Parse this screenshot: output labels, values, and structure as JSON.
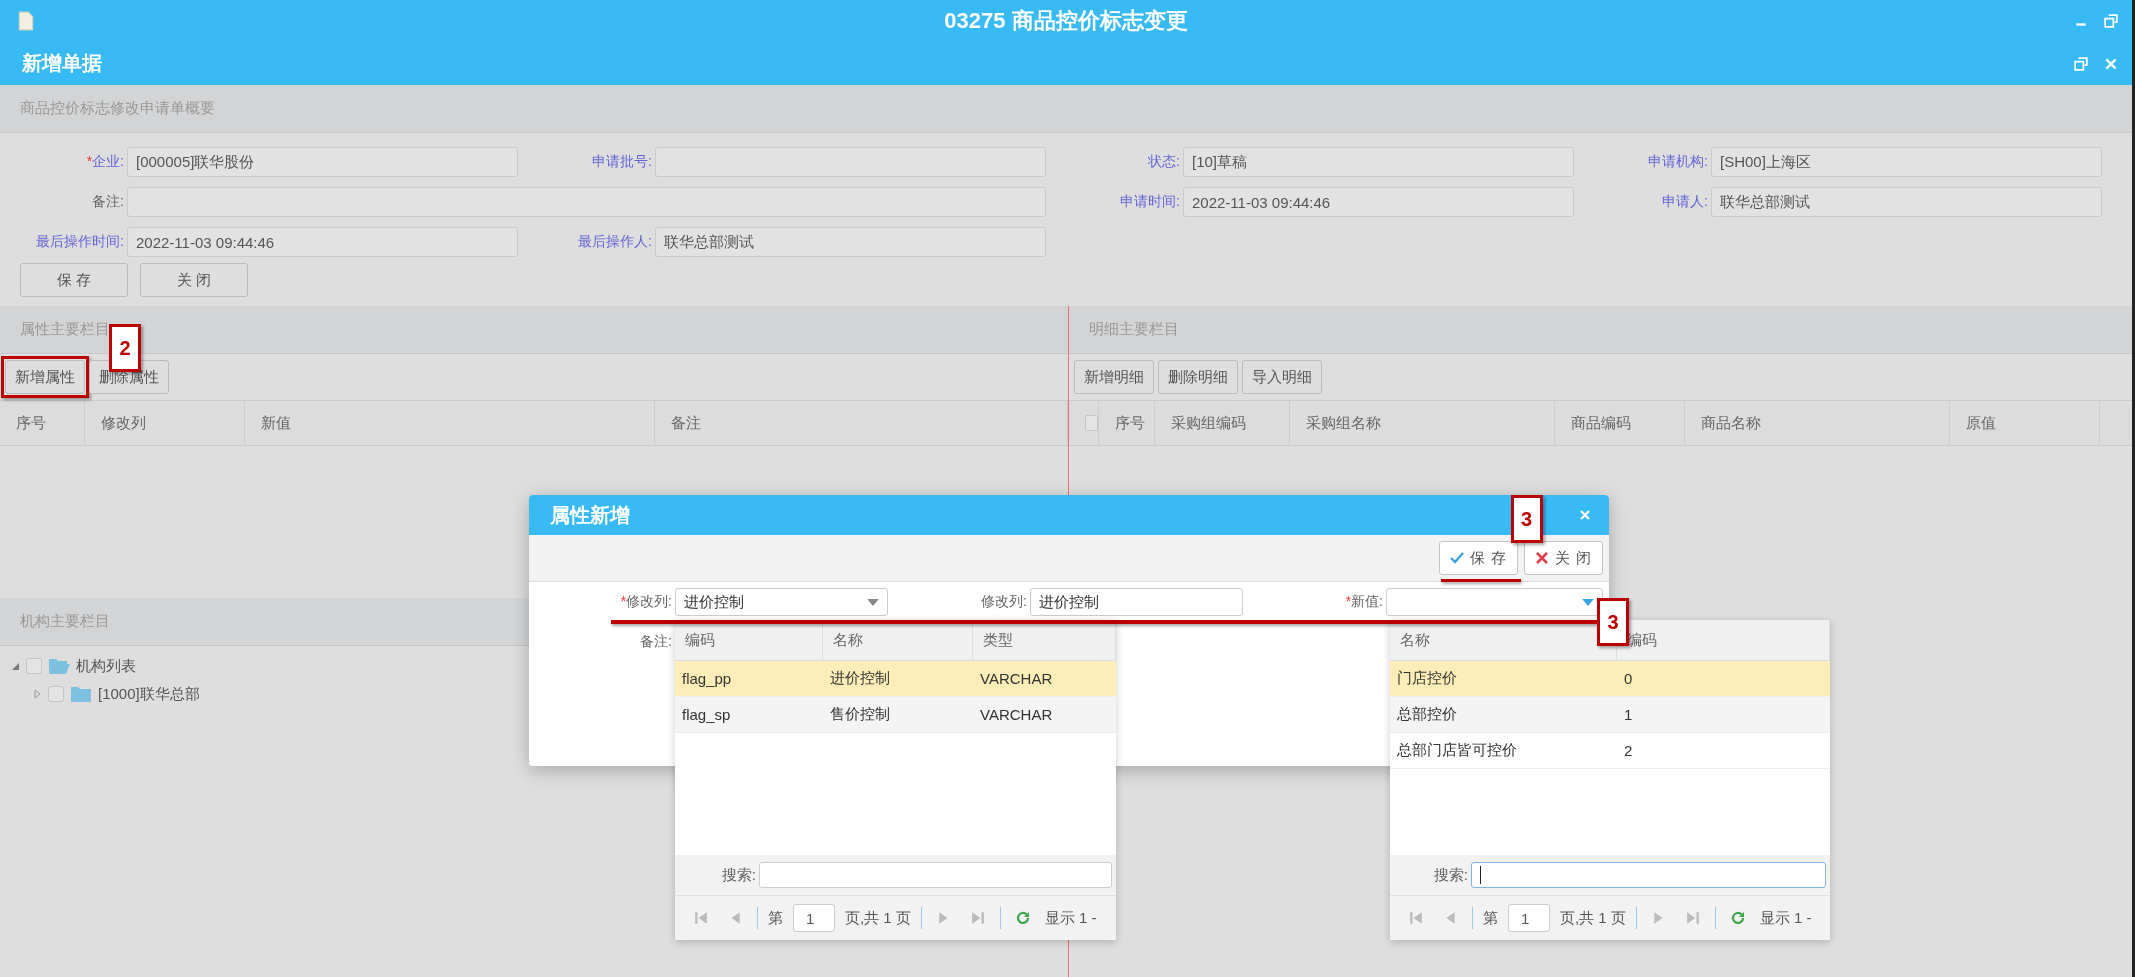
{
  "window": {
    "title": "03275 商品控价标志变更"
  },
  "subwindow": {
    "title": "新增单据"
  },
  "summary": {
    "title": "商品控价标志修改申请单概要",
    "fields": [
      {
        "marker": "*",
        "label": "企业:",
        "value": "[000005]联华股份",
        "kind": "normal",
        "emphasis": true
      },
      {
        "label": "申请批号:",
        "kind": "normal",
        "emphasis": true
      },
      {
        "label": "状态:",
        "value": "[10]草稿",
        "kind": "normal",
        "emphasis": true
      },
      {
        "label": "申请机构:",
        "value": "[SH00]上海区",
        "kind": "normal",
        "emphasis": true
      },
      {
        "label": "备注:",
        "kind": "wide",
        "emphasis": false
      },
      {
        "label": "申请时间:",
        "value": "2022-11-03 09:44:46",
        "kind": "normal",
        "emphasis": true
      },
      {
        "label": "申请人:",
        "value": "联华总部测试",
        "kind": "normal",
        "emphasis": true
      },
      {
        "label": "最后操作时间:",
        "value": "2022-11-03 09:44:46",
        "kind": "normal",
        "emphasis": true
      },
      {
        "label": "最后操作人:",
        "value": "联华总部测试",
        "kind": "normal",
        "emphasis": true
      }
    ],
    "buttons": [
      "保 存",
      "关 闭"
    ]
  },
  "attr_panel": {
    "title": "属性主要栏目",
    "buttons": [
      {
        "label": "新增属性",
        "annotation": "2"
      },
      {
        "label": "删除属性"
      }
    ],
    "columns": [
      "序号",
      "修改列",
      "新值",
      "备注"
    ]
  },
  "org_panel": {
    "title": "机构主要栏目",
    "tree": [
      {
        "label": "机构列表",
        "expanded": true,
        "checked": false,
        "children": [
          {
            "label": "[1000]联华总部",
            "expanded": false,
            "checked": false
          }
        ]
      }
    ]
  },
  "detail_panel": {
    "title": "明细主要栏目",
    "buttons": [
      "新增明细",
      "删除明细",
      "导入明细"
    ],
    "select_all": {
      "checked": false
    },
    "columns": [
      "序号",
      "采购组编码",
      "采购组名称",
      "商品编码",
      "商品名称",
      "原值"
    ]
  },
  "dialog": {
    "title": "属性新增",
    "buttons": [
      {
        "kind": "save",
        "label": "保 存",
        "annotation": "3"
      },
      {
        "kind": "close",
        "label": "关 闭"
      }
    ],
    "fields": [
      {
        "marker": "*",
        "label": "修改列:",
        "value": "进价控制",
        "kind": "combo",
        "active": false
      },
      {
        "label": "修改列:",
        "value": "进价控制",
        "kind": "text"
      },
      {
        "marker": "*",
        "label": "新值:",
        "kind": "combo",
        "active": true,
        "annotation": "3"
      }
    ],
    "remark_label": "备注:"
  },
  "dropdowns": [
    {
      "columns": [
        "编码",
        "名称",
        "类型"
      ],
      "rows": [
        {
          "cells": [
            "flag_pp",
            "进价控制",
            "VARCHAR"
          ],
          "selected": true
        },
        {
          "cells": [
            "flag_sp",
            "售价控制",
            "VARCHAR"
          ],
          "selected": false
        }
      ],
      "search_label": "搜索:",
      "search_focused": false,
      "pager": {
        "before": "第",
        "page": "1",
        "after": "页,共 1 页",
        "info": "显示 1 -"
      }
    },
    {
      "columns": [
        "名称",
        "编码"
      ],
      "rows": [
        {
          "cells": [
            "门店控价",
            "0"
          ],
          "selected": true
        },
        {
          "cells": [
            "总部控价",
            "1"
          ],
          "selected": false
        },
        {
          "cells": [
            "总部门店皆可控价",
            "2"
          ],
          "selected": false
        }
      ],
      "search_label": "搜索:",
      "search_focused": true,
      "pager": {
        "before": "第",
        "page": "1",
        "after": "页,共 1 页",
        "info": "显示 1 -"
      }
    }
  ]
}
